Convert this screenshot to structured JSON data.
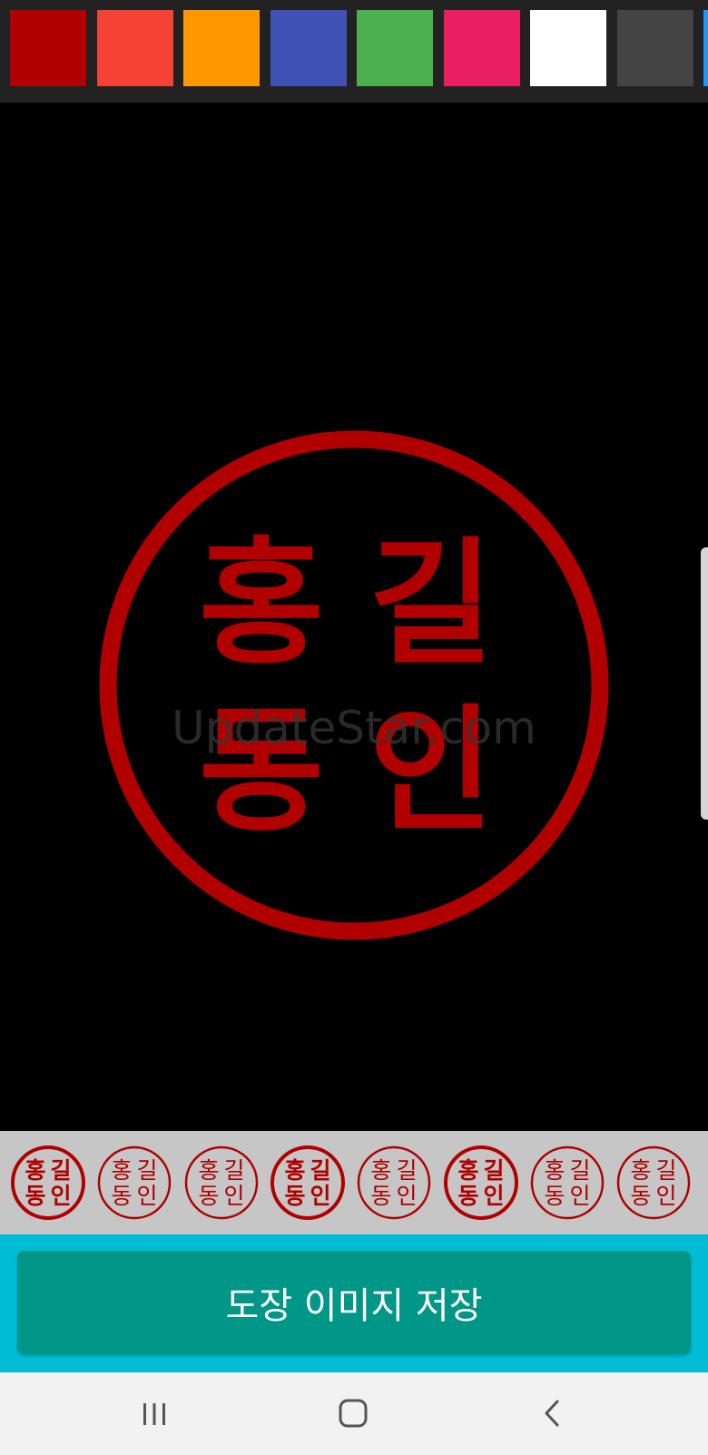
{
  "palette": {
    "swatches": [
      {
        "name": "dark-red",
        "color": "#b00000"
      },
      {
        "name": "red",
        "color": "#f44336"
      },
      {
        "name": "orange",
        "color": "#ff9800"
      },
      {
        "name": "indigo",
        "color": "#3f51b5"
      },
      {
        "name": "green",
        "color": "#4caf50"
      },
      {
        "name": "pink",
        "color": "#e91e63"
      },
      {
        "name": "white",
        "color": "#ffffff"
      },
      {
        "name": "dark-gray",
        "color": "#444444"
      },
      {
        "name": "blue",
        "color": "#2196f3"
      }
    ]
  },
  "stamp": {
    "chars": [
      "홍",
      "길",
      "동",
      "인"
    ],
    "color": "#b00000"
  },
  "watermark": {
    "text": "UpdateStar.com"
  },
  "styles": {
    "items": [
      {
        "chars": [
          "홍",
          "길",
          "동",
          "인"
        ],
        "weight": "bold"
      },
      {
        "chars": [
          "홍",
          "길",
          "동",
          "인"
        ],
        "weight": "normal"
      },
      {
        "chars": [
          "홍",
          "길",
          "동",
          "인"
        ],
        "weight": "normal"
      },
      {
        "chars": [
          "홍",
          "길",
          "동",
          "인"
        ],
        "weight": "bold"
      },
      {
        "chars": [
          "홍",
          "길",
          "동",
          "인"
        ],
        "weight": "normal"
      },
      {
        "chars": [
          "홍",
          "길",
          "동",
          "인"
        ],
        "weight": "bold"
      },
      {
        "chars": [
          "홍",
          "길",
          "동",
          "인"
        ],
        "weight": "normal"
      },
      {
        "chars": [
          "홍",
          "길",
          "동",
          "인"
        ],
        "weight": "normal"
      }
    ],
    "color": "#b00000"
  },
  "save_button": {
    "label": "도장 이미지 저장"
  },
  "navbar": {
    "recent_icon": "recent-apps-icon",
    "home_icon": "home-icon",
    "back_icon": "back-icon"
  }
}
